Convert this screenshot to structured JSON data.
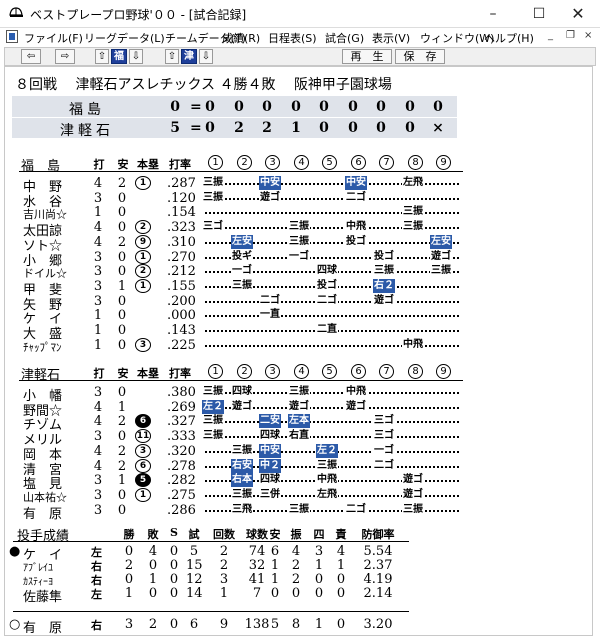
{
  "window": {
    "title": "ベストプレープロ野球'００ - [試合記録]",
    "minimize": "–",
    "maximize": "☐",
    "close": "✕"
  },
  "menu": [
    "ファイル(F)",
    "リーグデータ(L)",
    "チームデータ(T)",
    "成績(R)",
    "日程表(S)",
    "試合(G)",
    "表示(V)",
    "ウィンドウ(W)",
    "ヘルプ(H)"
  ],
  "mdi": {
    "min": "_",
    "restore": "❐",
    "close": "×"
  },
  "toolbar": {
    "prev": "⇦",
    "next": "⇨",
    "up1": "⇧",
    "team1": "福",
    "down1": "⇩",
    "up2": "⇧",
    "team2": "津",
    "down2": "⇩",
    "replay": "再　生",
    "save": "保　存"
  },
  "game": {
    "round": "８回戦",
    "team_record": "津軽石アスレチックス ４勝４敗",
    "stadium": "阪神甲子園球場"
  },
  "line_score": [
    {
      "team": "福島",
      "total": "0",
      "eq": "=",
      "innings": [
        "0",
        "0",
        "0",
        "0",
        "0",
        "0",
        "0",
        "0",
        "0"
      ]
    },
    {
      "team": "津軽石",
      "total": "5",
      "eq": "=",
      "innings": [
        "0",
        "2",
        "2",
        "1",
        "0",
        "0",
        "0",
        "0",
        "×"
      ]
    }
  ],
  "batting_headers": {
    "at_bats": "打",
    "hits": "安",
    "hr": "本塁",
    "avg": "打率",
    "innings": [
      "1",
      "2",
      "3",
      "4",
      "5",
      "6",
      "7",
      "8",
      "9"
    ]
  },
  "away": {
    "team": "福　島",
    "players": [
      {
        "name": "中　野",
        "ab": "4",
        "h": "2",
        "hr": "1",
        "avg": ".287",
        "pa": [
          {
            "i": 1,
            "t": "三振",
            "hit": false
          },
          {
            "i": 3,
            "t": "中安",
            "hit": true
          },
          {
            "i": 6,
            "t": "中安",
            "hit": true
          },
          {
            "i": 8,
            "t": "左飛",
            "hit": false
          }
        ]
      },
      {
        "name": "水　谷",
        "ab": "3",
        "h": "0",
        "hr": "",
        "avg": ".120",
        "pa": [
          {
            "i": 1,
            "t": "三振",
            "hit": false
          },
          {
            "i": 3,
            "t": "遊ゴ",
            "hit": false
          },
          {
            "i": 6,
            "t": "二ゴ",
            "hit": false
          }
        ]
      },
      {
        "name": "吉川尚☆",
        "ab": "1",
        "h": "0",
        "hr": "",
        "avg": ".154",
        "small": true,
        "pa": [
          {
            "i": 8,
            "t": "三振",
            "hit": false
          }
        ]
      },
      {
        "name": "太田諒",
        "ab": "4",
        "h": "0",
        "hr": "2",
        "avg": ".323",
        "pa": [
          {
            "i": 1,
            "t": "三ゴ",
            "hit": false
          },
          {
            "i": 4,
            "t": "三振",
            "hit": false
          },
          {
            "i": 6,
            "t": "中飛",
            "hit": false
          },
          {
            "i": 8,
            "t": "三振",
            "hit": false
          }
        ]
      },
      {
        "name": "ソト☆",
        "ab": "4",
        "h": "2",
        "hr": "9",
        "avg": ".310",
        "pa": [
          {
            "i": 2,
            "t": "左安",
            "hit": true
          },
          {
            "i": 4,
            "t": "三振",
            "hit": false
          },
          {
            "i": 6,
            "t": "投ゴ",
            "hit": false
          },
          {
            "i": 9,
            "t": "左安",
            "hit": true
          }
        ]
      },
      {
        "name": "小　郷",
        "ab": "3",
        "h": "0",
        "hr": "1",
        "avg": ".270",
        "pa": [
          {
            "i": 2,
            "t": "投ギ",
            "hit": false
          },
          {
            "i": 4,
            "t": "一ゴ",
            "hit": false
          },
          {
            "i": 7,
            "t": "投ゴ",
            "hit": false
          },
          {
            "i": 9,
            "t": "遊ゴ",
            "hit": false
          }
        ]
      },
      {
        "name": "ドイル☆",
        "ab": "3",
        "h": "0",
        "hr": "2",
        "avg": ".212",
        "small": true,
        "pa": [
          {
            "i": 2,
            "t": "一ゴ",
            "hit": false
          },
          {
            "i": 5,
            "t": "四球",
            "hit": false
          },
          {
            "i": 7,
            "t": "三振",
            "hit": false
          },
          {
            "i": 9,
            "t": "三振",
            "hit": false
          }
        ]
      },
      {
        "name": "甲　斐",
        "ab": "3",
        "h": "1",
        "hr": "1",
        "avg": ".155",
        "pa": [
          {
            "i": 2,
            "t": "三振",
            "hit": false
          },
          {
            "i": 5,
            "t": "投ゴ",
            "hit": false
          },
          {
            "i": 7,
            "t": "右２",
            "hit": true
          }
        ]
      },
      {
        "name": "矢　野",
        "ab": "3",
        "h": "0",
        "hr": "",
        "avg": ".200",
        "pa": [
          {
            "i": 3,
            "t": "二ゴ",
            "hit": false
          },
          {
            "i": 5,
            "t": "二ゴ",
            "hit": false
          },
          {
            "i": 7,
            "t": "遊ゴ",
            "hit": false
          }
        ]
      },
      {
        "name": "ケ　イ",
        "ab": "1",
        "h": "0",
        "hr": "",
        "avg": ".000",
        "pa": [
          {
            "i": 3,
            "t": "一直",
            "hit": false
          }
        ]
      },
      {
        "name": "大　盛",
        "ab": "1",
        "h": "0",
        "hr": "",
        "avg": ".143",
        "pa": [
          {
            "i": 5,
            "t": "二直",
            "hit": false
          }
        ]
      },
      {
        "name": "ﾁｬｯﾌﾟﾏﾝ",
        "ab": "1",
        "h": "0",
        "hr": "3",
        "avg": ".225",
        "small": true,
        "pa": [
          {
            "i": 8,
            "t": "中飛",
            "hit": false
          }
        ]
      }
    ]
  },
  "home": {
    "team": "津軽石",
    "players": [
      {
        "name": "小　幡",
        "ab": "3",
        "h": "0",
        "hr": "",
        "avg": ".380",
        "pa": [
          {
            "i": 1,
            "t": "三振",
            "hit": false
          },
          {
            "i": 2,
            "t": "四球",
            "hit": false
          },
          {
            "i": 4,
            "t": "三振",
            "hit": false
          },
          {
            "i": 6,
            "t": "中飛",
            "hit": false
          }
        ]
      },
      {
        "name": "野間☆",
        "ab": "4",
        "h": "1",
        "hr": "",
        "avg": ".269",
        "pa": [
          {
            "i": 1,
            "t": "左２",
            "hit": true
          },
          {
            "i": 2,
            "t": "遊ゴ",
            "hit": false
          },
          {
            "i": 4,
            "t": "遊ゴ",
            "hit": false
          },
          {
            "i": 6,
            "t": "遊ゴ",
            "hit": false
          }
        ]
      },
      {
        "name": "チゾム",
        "ab": "4",
        "h": "2",
        "hr": "6",
        "avg": ".327",
        "hrfill": true,
        "pa": [
          {
            "i": 1,
            "t": "三振",
            "hit": false
          },
          {
            "i": 3,
            "t": "二安",
            "hit": true
          },
          {
            "i": 4,
            "t": "左本",
            "hit": true
          },
          {
            "i": 7,
            "t": "三ゴ",
            "hit": false
          }
        ]
      },
      {
        "name": "メリル",
        "ab": "3",
        "h": "0",
        "hr": "11",
        "avg": ".333",
        "pa": [
          {
            "i": 1,
            "t": "三振",
            "hit": false
          },
          {
            "i": 3,
            "t": "四球",
            "hit": false
          },
          {
            "i": 4,
            "t": "右直",
            "hit": false
          },
          {
            "i": 7,
            "t": "三ゴ",
            "hit": false
          }
        ]
      },
      {
        "name": "岡　本",
        "ab": "4",
        "h": "2",
        "hr": "3",
        "avg": ".320",
        "pa": [
          {
            "i": 2,
            "t": "三振",
            "hit": false
          },
          {
            "i": 3,
            "t": "中安",
            "hit": true
          },
          {
            "i": 5,
            "t": "左２",
            "hit": true
          },
          {
            "i": 7,
            "t": "一ゴ",
            "hit": false
          }
        ]
      },
      {
        "name": "清　宮",
        "ab": "4",
        "h": "2",
        "hr": "6",
        "avg": ".278",
        "pa": [
          {
            "i": 2,
            "t": "右安",
            "hit": true
          },
          {
            "i": 3,
            "t": "中２",
            "hit": true
          },
          {
            "i": 5,
            "t": "三振",
            "hit": false
          },
          {
            "i": 7,
            "t": "二ゴ",
            "hit": false
          }
        ]
      },
      {
        "name": "塩　見",
        "ab": "3",
        "h": "1",
        "hr": "5",
        "avg": ".282",
        "hrfill": true,
        "pa": [
          {
            "i": 2,
            "t": "右本",
            "hit": true
          },
          {
            "i": 3,
            "t": "四球",
            "hit": false
          },
          {
            "i": 5,
            "t": "中飛",
            "hit": false
          },
          {
            "i": 8,
            "t": "遊ゴ",
            "hit": false
          }
        ]
      },
      {
        "name": "山本祐☆",
        "ab": "3",
        "h": "0",
        "hr": "1",
        "avg": ".275",
        "small": true,
        "pa": [
          {
            "i": 2,
            "t": "三振",
            "hit": false
          },
          {
            "i": 3,
            "t": "三併",
            "hit": false
          },
          {
            "i": 5,
            "t": "左飛",
            "hit": false
          },
          {
            "i": 8,
            "t": "遊ゴ",
            "hit": false
          }
        ]
      },
      {
        "name": "有　原",
        "ab": "3",
        "h": "0",
        "hr": "",
        "avg": ".286",
        "pa": [
          {
            "i": 2,
            "t": "三飛",
            "hit": false
          },
          {
            "i": 4,
            "t": "三振",
            "hit": false
          },
          {
            "i": 6,
            "t": "二ゴ",
            "hit": false
          },
          {
            "i": 8,
            "t": "三振",
            "hit": false
          }
        ]
      }
    ]
  },
  "pitching": {
    "title": "投手成績",
    "headers": [
      "勝",
      "敗",
      "S",
      "試",
      "回数",
      "球数",
      "安",
      "振",
      "四",
      "責",
      "防御率"
    ],
    "rows": [
      {
        "mark": "●",
        "name": "ケ　イ",
        "hand": "左",
        "vals": [
          "0",
          "4",
          "0",
          "5",
          "2",
          "74",
          "6",
          "4",
          "3",
          "4"
        ],
        "era": "5.54"
      },
      {
        "mark": "",
        "name": "ｱﾌﾞﾚｲﾕ",
        "small": true,
        "hand": "右",
        "vals": [
          "2",
          "0",
          "0",
          "15",
          "2",
          "32",
          "1",
          "2",
          "1",
          "1"
        ],
        "era": "2.37"
      },
      {
        "mark": "",
        "name": "ｶｽﾃｨｰﾖ",
        "small": true,
        "hand": "右",
        "vals": [
          "0",
          "1",
          "0",
          "12",
          "3",
          "41",
          "1",
          "2",
          "0",
          "0"
        ],
        "era": "4.19"
      },
      {
        "mark": "",
        "name": "佐藤隼",
        "hand": "左",
        "vals": [
          "1",
          "0",
          "0",
          "14",
          "1",
          "7",
          "0",
          "0",
          "0",
          "0"
        ],
        "era": "2.14"
      },
      {
        "mark": "○",
        "name": "有　原",
        "hand": "右",
        "vals": [
          "3",
          "2",
          "0",
          "6",
          "9",
          "138",
          "5",
          "8",
          "1",
          "0"
        ],
        "era": "3.20"
      }
    ]
  }
}
